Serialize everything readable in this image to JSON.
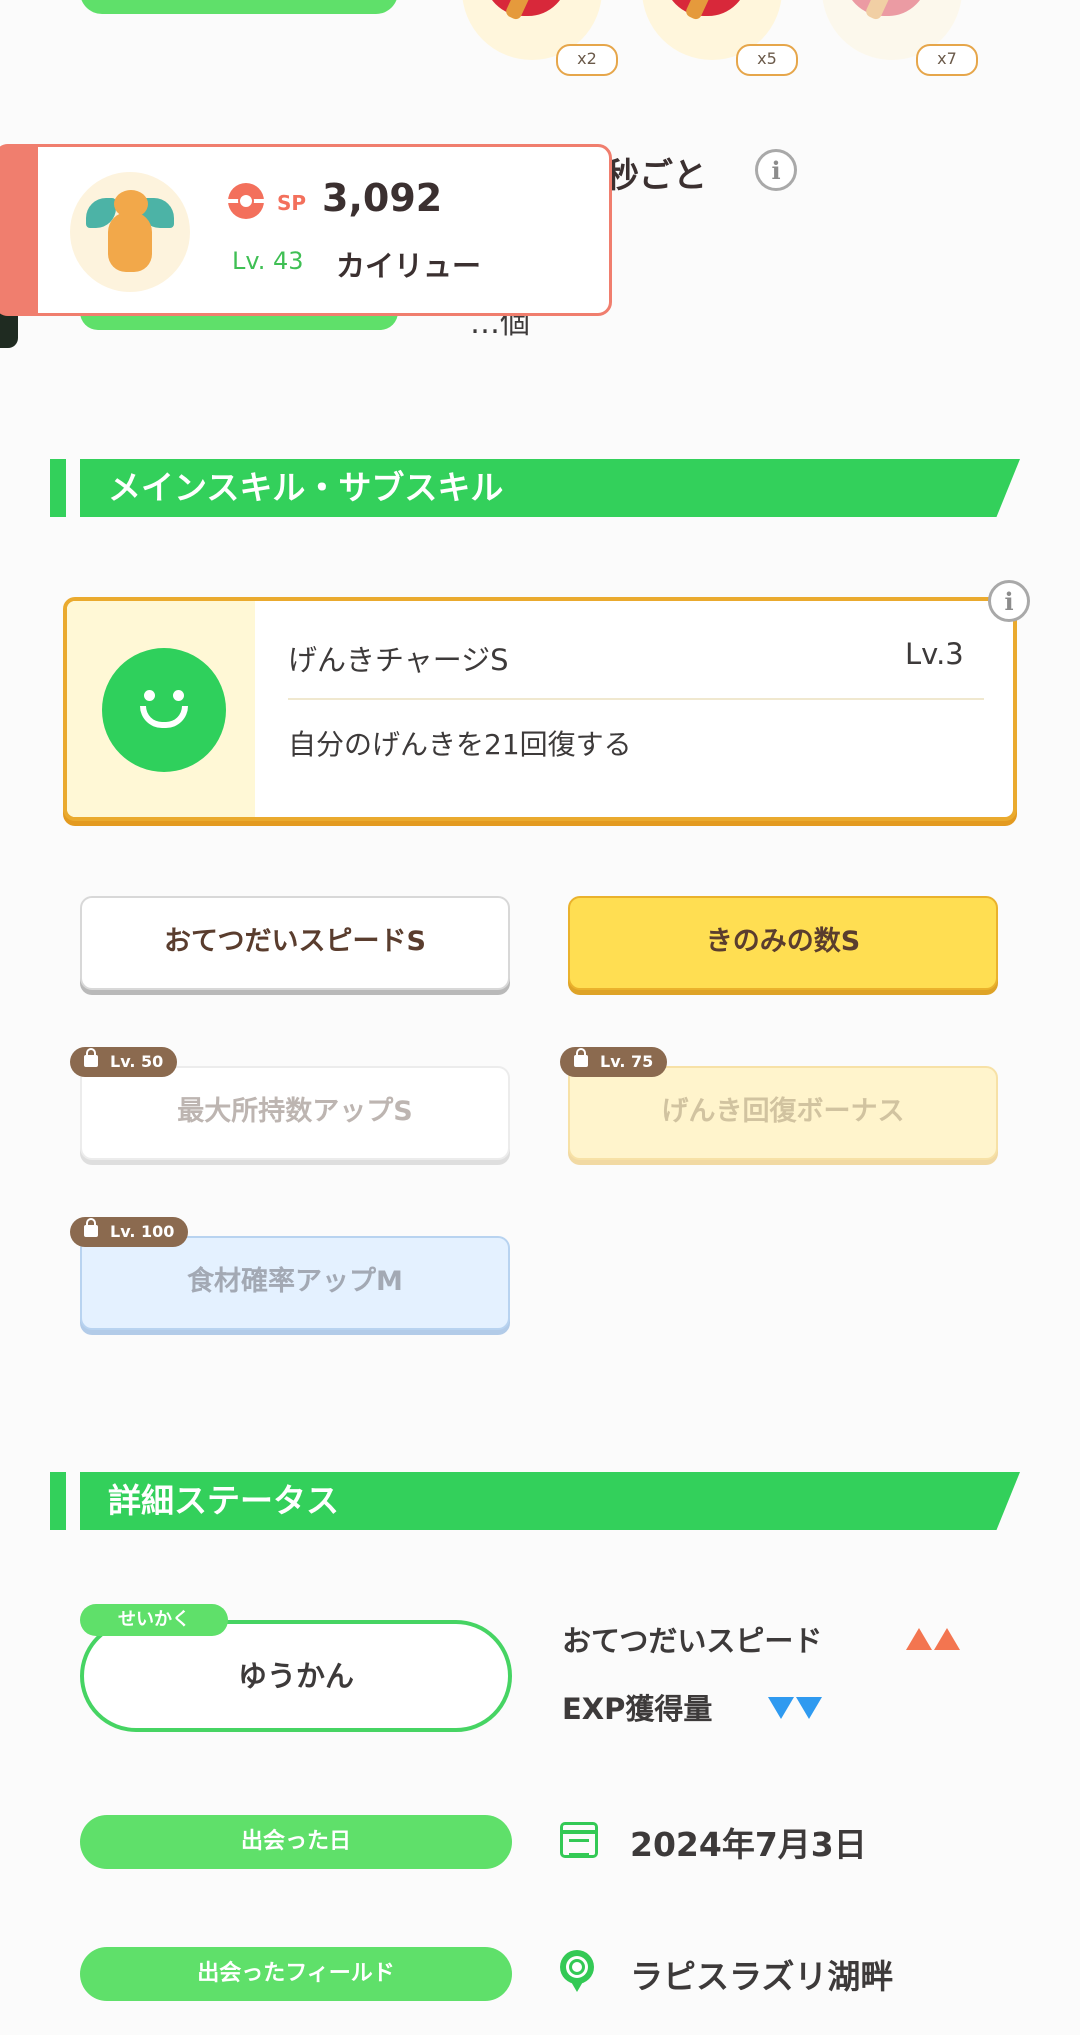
{
  "ingredients": {
    "multipliers": [
      "x2",
      "x5",
      "x7"
    ]
  },
  "partial_row": {
    "text": "秒ごと",
    "hidden_text": "…個"
  },
  "popup": {
    "sp_label": "SP",
    "sp_value": "3,092",
    "level": "Lv. 43",
    "name": "カイリュー"
  },
  "skills_section": {
    "title": "メインスキル・サブスキル",
    "main_skill": {
      "name": "げんきチャージS",
      "level": "Lv.3",
      "description": "自分のげんきを21回復する"
    },
    "sub_skills": [
      {
        "label": "おてつだいスピードS",
        "lock": ""
      },
      {
        "label": "きのみの数S",
        "lock": ""
      },
      {
        "label": "最大所持数アップS",
        "lock": "Lv. 50"
      },
      {
        "label": "げんき回復ボーナス",
        "lock": "Lv. 75"
      },
      {
        "label": "食材確率アップM",
        "lock": "Lv. 100"
      }
    ]
  },
  "status_section": {
    "title": "詳細ステータス",
    "nature_tag": "せいかく",
    "nature": "ゆうかん",
    "up_effect": "おてつだいスピード",
    "down_effect": "EXP獲得量",
    "met_date_label": "出会った日",
    "met_date": "2024年7月3日",
    "met_field_label": "出会ったフィールド",
    "met_field": "ラピスラズリ湖畔"
  },
  "colors": {
    "accent_green": "#33d05b",
    "popup_border": "#f07e6e",
    "skill_gold": "#eaaa2e",
    "up_arrow": "#f37550",
    "down_arrow": "#2f9af0"
  }
}
